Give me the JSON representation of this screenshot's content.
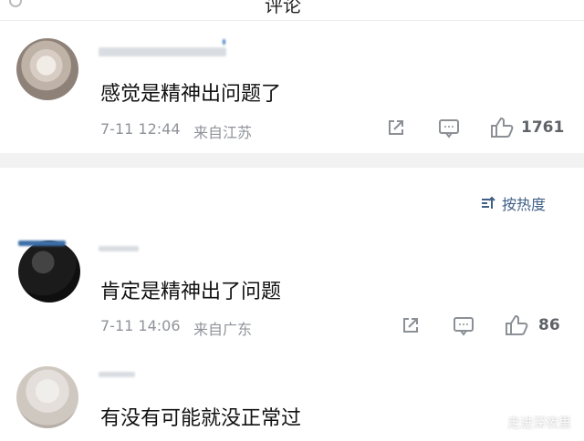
{
  "header": {
    "title": "评论"
  },
  "sort": {
    "label": "按热度"
  },
  "comments": [
    {
      "text": "感觉是精神出问题了",
      "time": "7-11 12:44",
      "location": "来自江苏",
      "likes": "1761"
    },
    {
      "text": "肯定是精神出了问题",
      "time": "7-11 14:06",
      "location": "来自广东",
      "likes": "86"
    },
    {
      "text": "有没有可能就没正常过"
    }
  ],
  "watermark": {
    "text": "走进深夜里"
  },
  "icons": [
    "share-icon",
    "comment-icon",
    "like-icon",
    "sort-icon"
  ],
  "colors": {
    "accent": "#3f5f86",
    "meta": "#8f9399",
    "divider_bg": "#f2f2f2"
  }
}
